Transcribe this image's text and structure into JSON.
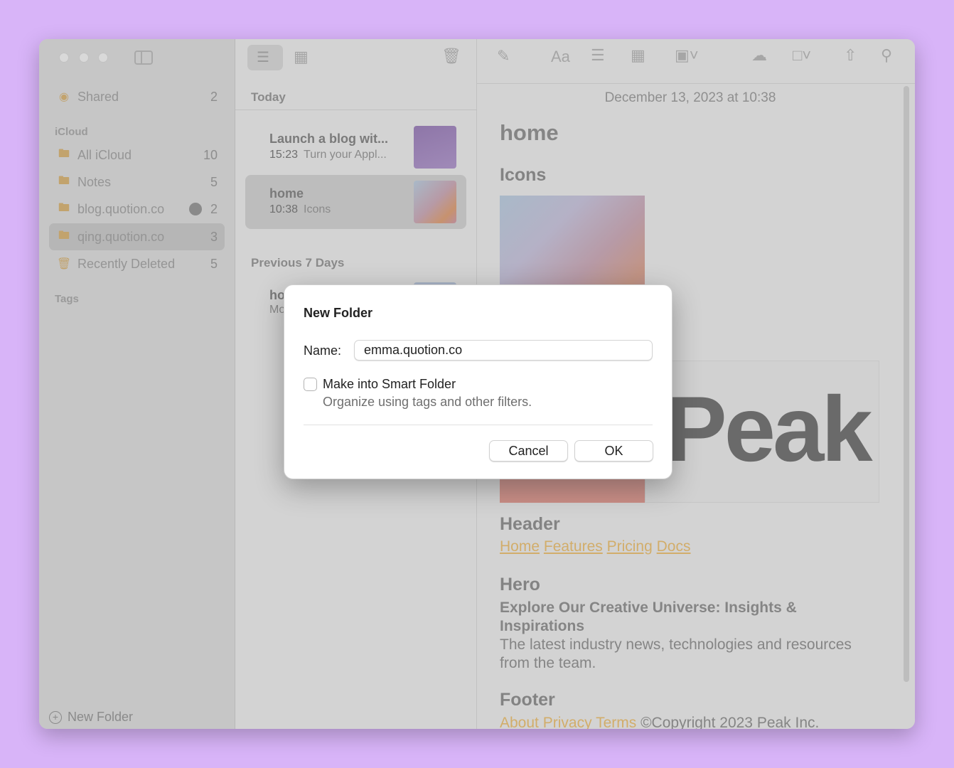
{
  "sidebar": {
    "shared": {
      "label": "Shared",
      "count": "2"
    },
    "icloud_header": "iCloud",
    "folders": [
      {
        "label": "All iCloud",
        "count": "10",
        "icon": "folder-icon"
      },
      {
        "label": "Notes",
        "count": "5",
        "icon": "folder-icon"
      },
      {
        "label": "blog.quotion.co",
        "count": "2",
        "icon": "shared-folder-icon"
      },
      {
        "label": "qing.quotion.co",
        "count": "3",
        "icon": "folder-icon"
      },
      {
        "label": "Recently Deleted",
        "count": "5",
        "icon": "trash-icon"
      }
    ],
    "tags_header": "Tags",
    "new_folder_label": "New Folder"
  },
  "note_list": {
    "today_header": "Today",
    "notes": [
      {
        "title": "Launch a blog wit...",
        "time": "15:23",
        "preview": "Turn your Appl..."
      },
      {
        "title": "home",
        "time": "10:38",
        "preview": "Icons"
      }
    ],
    "previous_header": "Previous 7 Days",
    "partial_note": {
      "title": "ho",
      "preview": "Mo"
    }
  },
  "editor": {
    "date": "December 13, 2023 at 10:38",
    "title": "home",
    "icons_heading": "Icons",
    "peak_text": "Peak",
    "header_heading": "Header",
    "header_links": [
      "Home",
      "Features",
      "Pricing",
      "Docs"
    ],
    "hero_heading": "Hero",
    "hero_title": "Explore Our Creative Universe: Insights & Inspirations",
    "hero_text": "The latest industry news, technologies and resources from the team.",
    "footer_heading": "Footer",
    "footer_links": [
      "About",
      "Privacy",
      "Terms"
    ],
    "footer_copy": "©Copyright 2023 Peak Inc."
  },
  "dialog": {
    "title": "New Folder",
    "name_label": "Name:",
    "name_value": "emma.quotion.co",
    "smart_folder_label": "Make into Smart Folder",
    "smart_folder_desc": "Organize using tags and other filters.",
    "smart_folder_checked": false,
    "cancel_label": "Cancel",
    "ok_label": "OK"
  },
  "toolbar": {
    "format_label": "Aa"
  },
  "colors": {
    "background": "#d8b4f8",
    "link": "#d2ad6a",
    "folder_icon": "#c2a36d"
  }
}
